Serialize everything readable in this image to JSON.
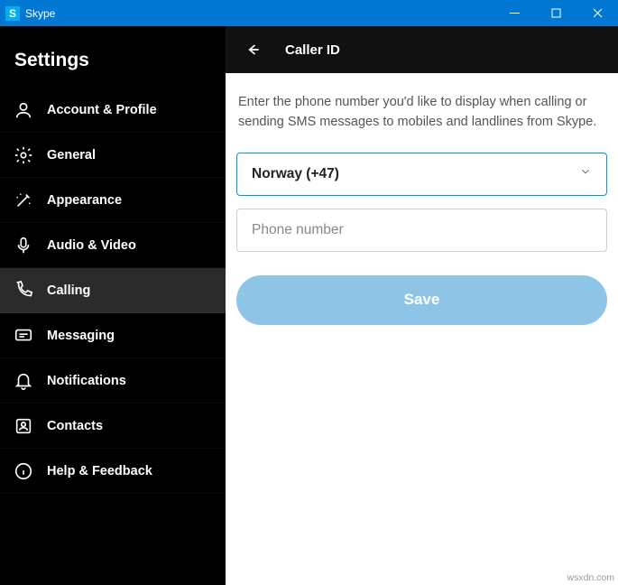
{
  "titlebar": {
    "title": "Skype",
    "icon_letter": "S"
  },
  "sidebar": {
    "header": "Settings",
    "items": [
      {
        "label": "Account & Profile",
        "icon": "user"
      },
      {
        "label": "General",
        "icon": "gear"
      },
      {
        "label": "Appearance",
        "icon": "wand"
      },
      {
        "label": "Audio & Video",
        "icon": "mic"
      },
      {
        "label": "Calling",
        "icon": "phone",
        "active": true
      },
      {
        "label": "Messaging",
        "icon": "message"
      },
      {
        "label": "Notifications",
        "icon": "bell"
      },
      {
        "label": "Contacts",
        "icon": "contacts"
      },
      {
        "label": "Help & Feedback",
        "icon": "info"
      }
    ]
  },
  "main": {
    "title": "Caller ID",
    "description": "Enter the phone number you'd like to display when calling or sending SMS messages to mobiles and landlines from Skype.",
    "country_value": "Norway (+47)",
    "phone_placeholder": "Phone number",
    "save_label": "Save"
  },
  "watermark": "wsxdn.com"
}
